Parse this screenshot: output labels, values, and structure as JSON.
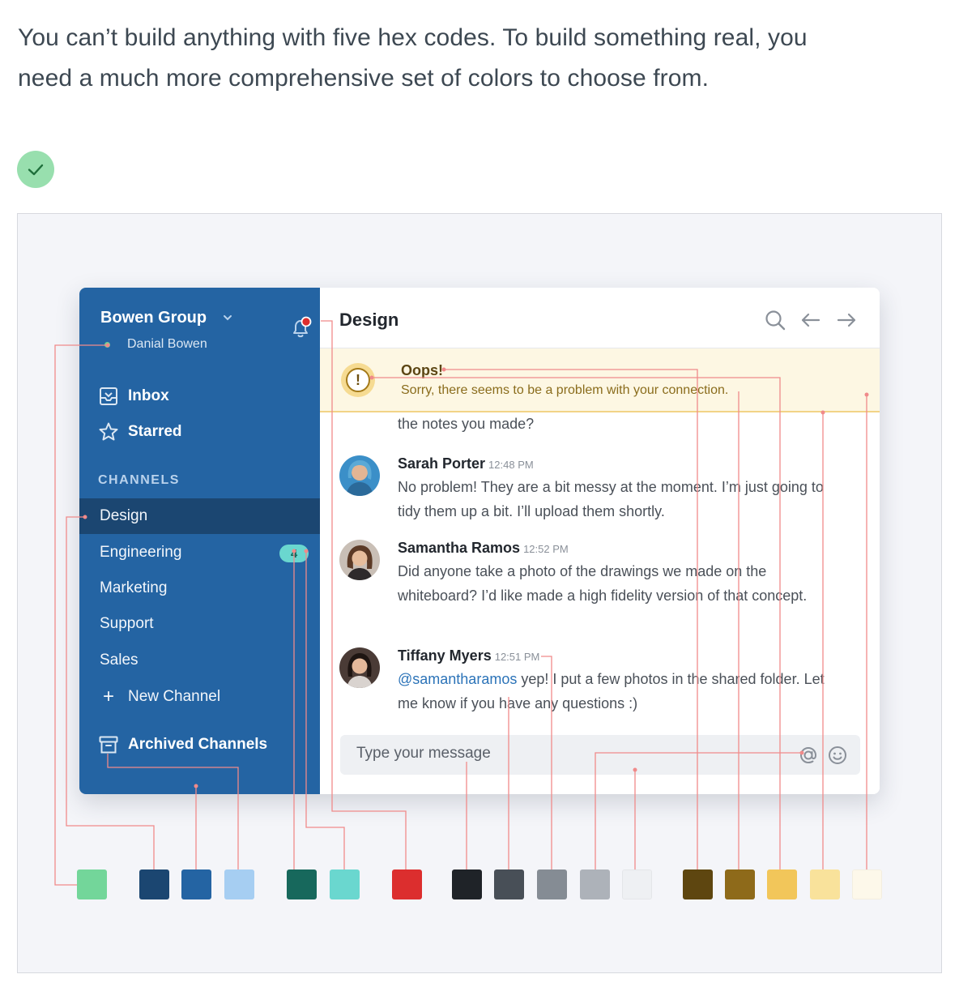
{
  "intro": {
    "line1": "You can’t build anything with five hex codes. To build something real, you",
    "line2": "need a much more comprehensive set of colors to choose from."
  },
  "sidebar": {
    "org_name": "Bowen Group",
    "user_name": "Danial Bowen",
    "nav": [
      {
        "label": "Inbox",
        "icon": "inbox-icon"
      },
      {
        "label": "Starred",
        "icon": "star-icon"
      }
    ],
    "channels_header": "CHANNELS",
    "channels": [
      {
        "label": "Design",
        "active": true
      },
      {
        "label": "Engineering",
        "badge": "4"
      },
      {
        "label": "Marketing"
      },
      {
        "label": "Support"
      },
      {
        "label": "Sales"
      }
    ],
    "new_channel": "New Channel",
    "archived": "Archived Channels"
  },
  "main": {
    "title": "Design",
    "alert": {
      "title": "Oops!",
      "text": "Sorry, there seems to be a problem with your connection."
    },
    "partial_message": "the notes you made?",
    "messages": [
      {
        "author": "Sarah Porter",
        "time": "12:48 PM",
        "body": "No problem! They are a bit messy at the moment. I’m just going to tidy them up a bit. I’ll upload them shortly."
      },
      {
        "author": "Samantha Ramos",
        "time": "12:52 PM",
        "body": "Did anyone take a photo of the drawings we made on the whiteboard? I’d like made a high fidelity version of that concept."
      },
      {
        "author": "Tiffany Myers",
        "time": "12:51 PM",
        "mention": "@samantharamos",
        "body": " yep! I put a few photos in the shared folder. Let me know if you have any questions :)"
      }
    ],
    "composer_placeholder": "Type your message"
  },
  "palette": [
    "#73d69a",
    "#1b4671",
    "#2464a3",
    "#a6cef2",
    "#17685c",
    "#6ad7cf",
    "#dc2e2e",
    "#1f2328",
    "#484f57",
    "#858c94",
    "#adb2b9",
    "#eef0f3",
    "#5e4610",
    "#8e6a1a",
    "#f2c65a",
    "#f9e29b",
    "#fdf8ea"
  ]
}
